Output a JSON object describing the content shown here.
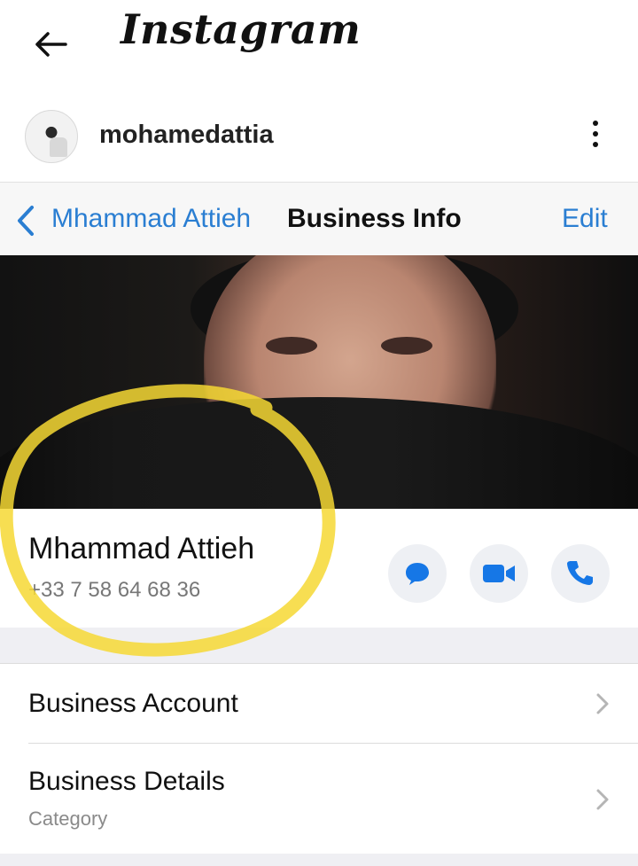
{
  "instagram": {
    "logo": "Instagram",
    "username": "mohamedattia"
  },
  "business_info": {
    "back_label": "Mhammad Attieh",
    "title": "Business Info",
    "edit_label": "Edit",
    "contact_name": "Mhammad Attieh",
    "contact_phone": "+33 7 58 64 68 36",
    "actions": [
      "chat-icon",
      "video-call-icon",
      "phone-icon"
    ],
    "rows": [
      {
        "title": "Business Account",
        "subtitle": ""
      },
      {
        "title": "Business Details",
        "subtitle": "Category"
      }
    ]
  },
  "colors": {
    "accent_blue": "#2a7ed2",
    "action_icon_blue": "#1677e6",
    "highlight_yellow": "#f6d834"
  }
}
